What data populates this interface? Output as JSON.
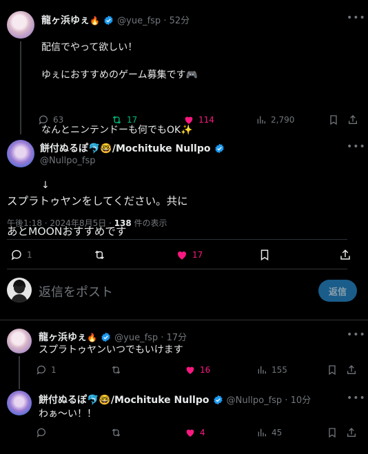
{
  "tweet1": {
    "name": "龍ヶ浜ゆぇ",
    "handle": "@yue_fsp",
    "time": "52分",
    "line1": "配信でやって欲しい！",
    "line2": "ゆぇにおすすめのゲーム募集です🎮",
    "line3": "なんとニンテンドーも何でもOK✨",
    "line4": "↓",
    "replies": "63",
    "reposts": "17",
    "likes": "114",
    "views": "2,790"
  },
  "main": {
    "name": "餅付ぬるぽ🐬🤓/Mochituke Nullpo",
    "handle": "@Nullpo_fsp",
    "line1": "スプラトゥヤンをしてください。共に",
    "line2": "あとMOONおすすめです",
    "meta_prefix": "午後1:18 · 2024年8月5日 · ",
    "views": "138",
    "views_suffix": " 件の表示",
    "replies": "1",
    "likes": "17"
  },
  "composer": {
    "placeholder": "返信をポスト",
    "button": "返信"
  },
  "reply1": {
    "name": "龍ヶ浜ゆぇ",
    "handle": "@yue_fsp",
    "time": "17分",
    "text": "スプラトゥヤンいつでもいけます",
    "replies": "1",
    "likes": "16",
    "views": "155"
  },
  "reply2": {
    "name": "餅付ぬるぽ🐬🤓/Mochituke Nullpo",
    "handle": "@Nullpo_fsp",
    "time": "10分",
    "text": "わぁ〜い！！",
    "likes": "4",
    "views": "45"
  },
  "colors": {
    "background": "#000000",
    "text": "#e7e9ea",
    "muted": "#71767b",
    "like_pink": "#f91880",
    "repost_green": "#00ba7c",
    "verified_blue": "#1d9bf0",
    "reply_button": "#1a5d8a"
  },
  "icons": [
    "reply-icon",
    "repost-icon",
    "heart-icon",
    "views-icon",
    "bookmark-icon",
    "share-icon",
    "more-icon",
    "verified-badge-icon",
    "fire-icon"
  ]
}
